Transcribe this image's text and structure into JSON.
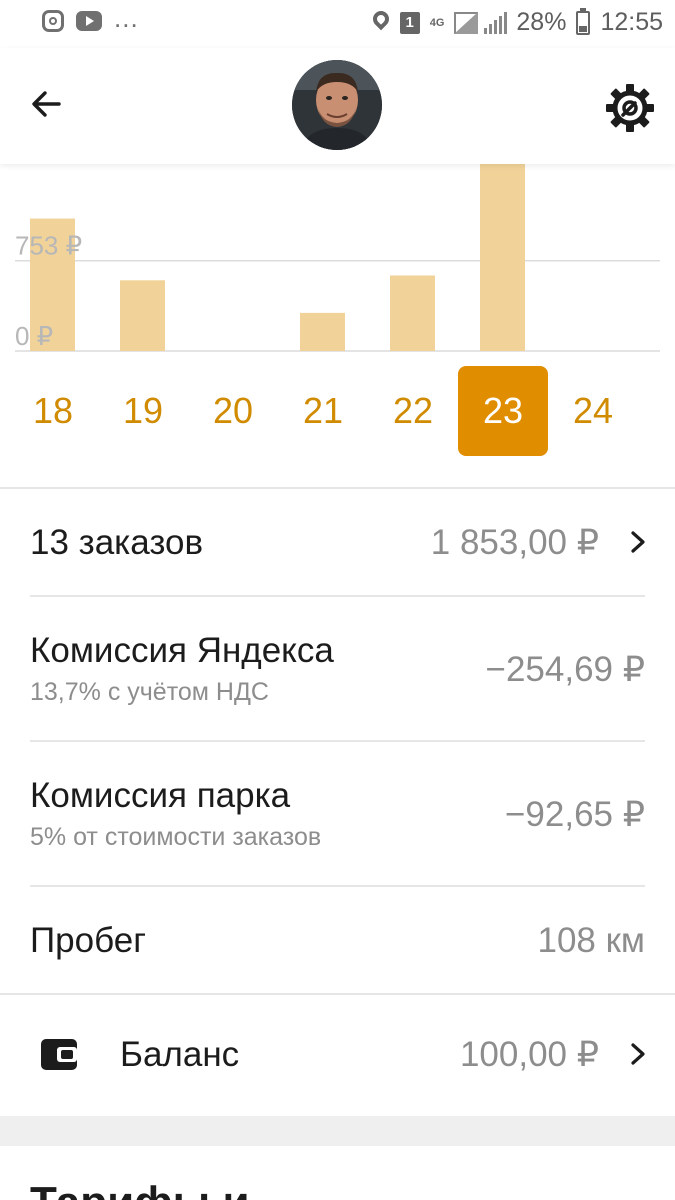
{
  "status_bar": {
    "left_icons": [
      "instagram-icon",
      "youtube-icon",
      "more-notifications-icon"
    ],
    "overflow_text": "...",
    "sim_label": "1",
    "network_label": "4G",
    "battery_percent": "28%",
    "time": "12:55"
  },
  "header": {
    "back_icon": "arrow-left-icon",
    "settings_icon": "gear-icon"
  },
  "chart_data": {
    "type": "bar",
    "categories": [
      "18",
      "19",
      "20",
      "21",
      "22",
      "23",
      "24"
    ],
    "values": [
      1105,
      590,
      0,
      318,
      630,
      1560,
      0
    ],
    "y_ticks": [
      "753 ₽",
      "0 ₽"
    ],
    "ylim": [
      0,
      1560
    ],
    "selected_category": "23",
    "bar_color": "#f1d39a",
    "selected_color": "#e08e00"
  },
  "stats": {
    "orders": {
      "label": "13 заказов",
      "value": "1 853,00 ₽"
    },
    "yandex_commission": {
      "label": "Комиссия Яндекса",
      "sublabel": "13,7% с учётом НДС",
      "value": "−254,69 ₽"
    },
    "park_commission": {
      "label": "Комиссия парка",
      "sublabel": "5% от стоимости заказов",
      "value": "−92,65 ₽"
    },
    "mileage": {
      "label": "Пробег",
      "value": "108 км"
    },
    "balance": {
      "label": "Баланс",
      "value": "100,00 ₽"
    }
  },
  "next_section": {
    "title": "Тарифы и ..."
  }
}
